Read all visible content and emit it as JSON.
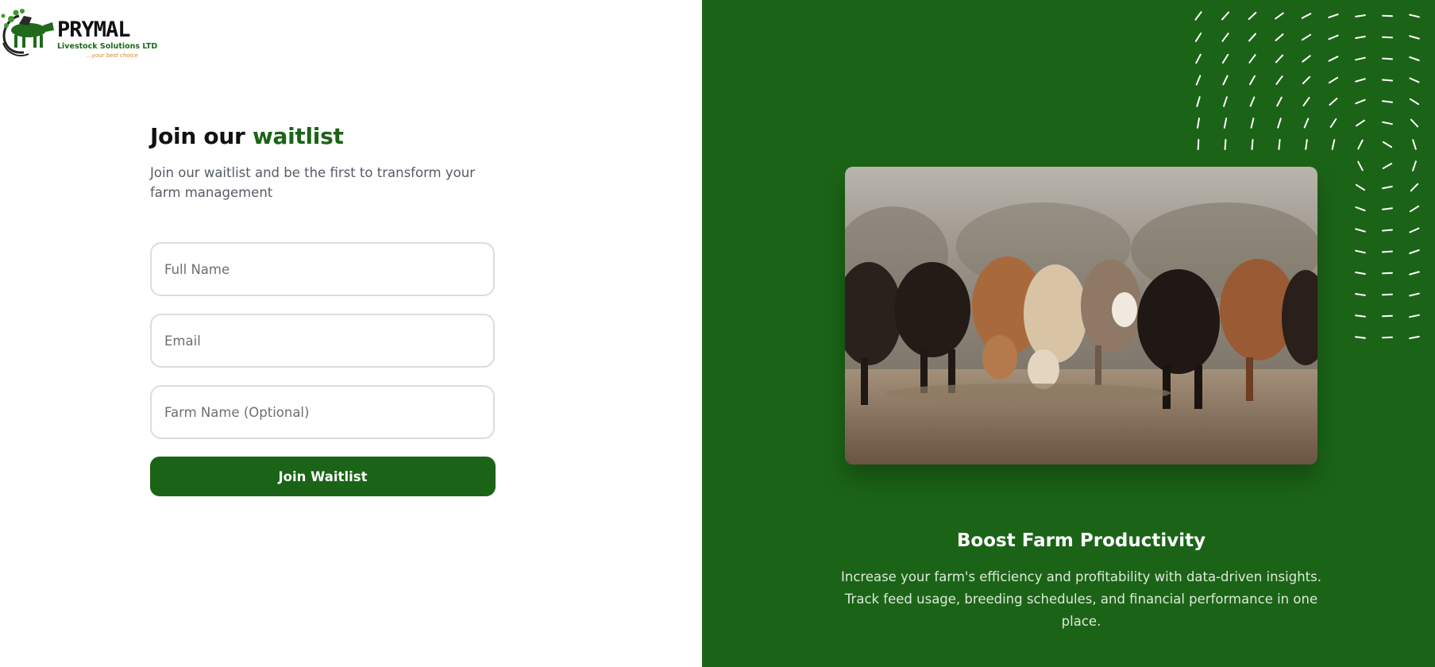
{
  "brand": {
    "name": "PRYMAL",
    "subtitle": "Livestock Solutions LTD",
    "tagline": "...your best choice",
    "primary_color": "#1b6417",
    "tagline_color": "#d2822a"
  },
  "form": {
    "heading_prefix": "Join our ",
    "heading_accent": "waitlist",
    "subtitle": "Join our waitlist and be the first to transform your farm management",
    "fields": [
      {
        "placeholder": "Full Name",
        "value": ""
      },
      {
        "placeholder": "Email",
        "value": ""
      },
      {
        "placeholder": "Farm Name (Optional)",
        "value": ""
      }
    ],
    "submit_label": "Join Waitlist"
  },
  "feature": {
    "image_icon": "cattle-herd-photo",
    "title": "Boost Farm Productivity",
    "description": "Increase your farm's efficiency and profitability with data-driven insights. Track feed usage, breeding schedules, and financial performance in one place."
  }
}
